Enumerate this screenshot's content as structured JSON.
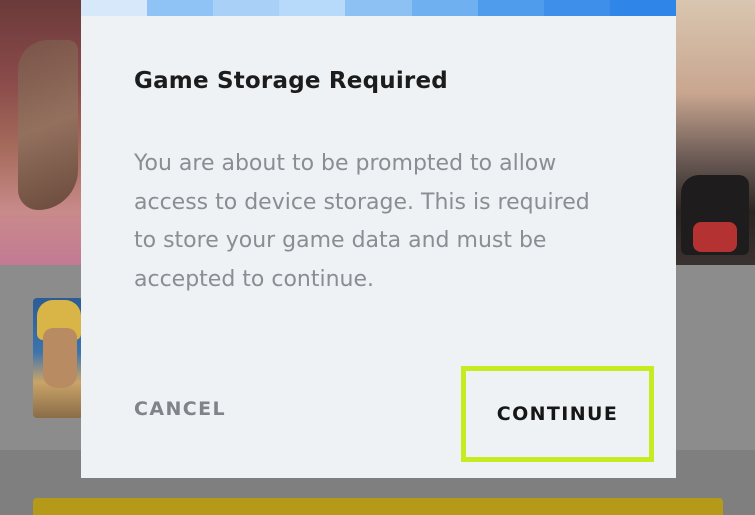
{
  "dialog": {
    "title": "Game Storage Required",
    "body": "You are about to be prompted to allow access to device storage. This is required to store your game data and must be accepted to continue.",
    "cancel_label": "CANCEL",
    "continue_label": "CONTINUE"
  },
  "colors": {
    "highlight": "#c7ea20",
    "progress_accent": "#2f86e8",
    "dialog_background": "#eef2f5"
  }
}
